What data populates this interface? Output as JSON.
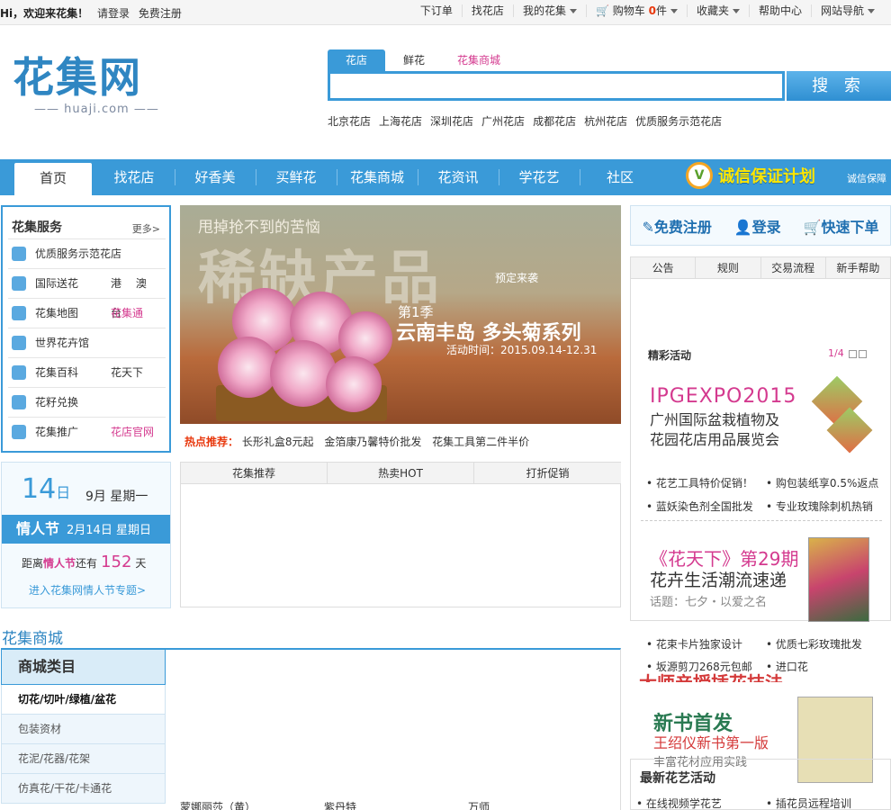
{
  "topbar": {
    "greeting": "Hi，欢迎来花集！",
    "login": "请登录",
    "register": "免费注册",
    "links": [
      "下订单",
      "找花店",
      "我的花集",
      "购物车",
      "0",
      "件",
      "收藏夹",
      "帮助中心",
      "网站导航"
    ]
  },
  "logo": {
    "cn": "花集网",
    "en": "huaji.com"
  },
  "search": {
    "tabs": [
      "花店",
      "鲜花",
      "花集商城"
    ],
    "button": "搜 索",
    "hot_cities": [
      "北京花店",
      "上海花店",
      "深圳花店",
      "广州花店",
      "成都花店",
      "杭州花店",
      "优质服务示范花店"
    ]
  },
  "nav": {
    "items": [
      "首页",
      "找花店",
      "好香美",
      "买鲜花",
      "花集商城",
      "花资讯",
      "学花艺",
      "社区"
    ],
    "trust_title": "诚信保证计划",
    "trust_badge": "V",
    "trust_side": "诚信保障"
  },
  "services": {
    "title": "花集服务",
    "more": "更多>",
    "rows": [
      {
        "label": "优质服务示范花店",
        "extra": ""
      },
      {
        "label": "国际送花",
        "extra": "港 澳 台"
      },
      {
        "label": "花集地图",
        "extra": "花集通"
      },
      {
        "label": "世界花卉馆",
        "extra": ""
      },
      {
        "label": "花集百科",
        "extra": "花天下"
      },
      {
        "label": "花籽兑换",
        "extra": ""
      },
      {
        "label": "花集推广",
        "extra": "花店官网"
      }
    ]
  },
  "calendar": {
    "day": "14",
    "day_unit": "日",
    "month_week": "9月 星期一",
    "festival": "情人节",
    "festival_date": "2月14日 星期日",
    "countdown_pre": "距离",
    "countdown_name": "情人节",
    "countdown_mid": "还有",
    "countdown_days": "152",
    "countdown_unit": "天",
    "link": "进入花集网情人节专题>"
  },
  "banner": {
    "line1": "甩掉抢不到的苦恼",
    "line2": "稀缺产品",
    "line3": "预定来袭",
    "season": "第1季",
    "series": "云南丰岛 多头菊系列",
    "period": "活动时间：2015.09.14-12.31"
  },
  "hot_rec": {
    "label": "热点推荐：",
    "items": [
      "长形礼盒8元起",
      "金箔康乃馨特价批发",
      "花集工具第二件半价"
    ]
  },
  "mid_tabs": [
    "花集推荐",
    "热卖HOT",
    "打折促销"
  ],
  "right": {
    "reg_links": [
      "免费注册",
      "登录",
      "快速下单"
    ],
    "tabs": [
      "公告",
      "规则",
      "交易流程",
      "新手帮助"
    ],
    "activity_title": "精彩活动",
    "activity_page": "1/4",
    "expo_title": "IPGEXPO2015",
    "expo_sub1": "广州国际盆栽植物及",
    "expo_sub2": "花园花店用品展览会",
    "list1": [
      "花艺工具特价促销！",
      "购包装纸享0.5%返点",
      "蓝妖染色剂全国批发",
      "专业玫瑰除刺机热销"
    ],
    "mag_title": "《花天下》第29期",
    "mag_sub": "花卉生活潮流速递",
    "mag_topic": "话题：七夕・以爱之名",
    "list2": [
      "花束卡片独家设计",
      "优质七彩玫瑰批发",
      "坂源剪刀268元包邮",
      "进口花"
    ],
    "masters": "大师亲授插花技法",
    "book_title": "新书首发",
    "book_sub": "王绍仪新书第一版",
    "book_desc": "丰富花材应用实践",
    "new_act": "最新花艺活动",
    "new_act_items": [
      "在线视频学花艺",
      "插花员远程培训"
    ]
  },
  "mall": {
    "title": "花集商城",
    "cat_header": "商城类目",
    "categories": [
      "切花/切叶/绿植/盆花",
      "包装资材",
      "花泥/花器/花架",
      "仿真花/干花/卡通花"
    ],
    "products": [
      "蒙娜丽莎（黄）",
      "紫丹特",
      "万师"
    ]
  }
}
